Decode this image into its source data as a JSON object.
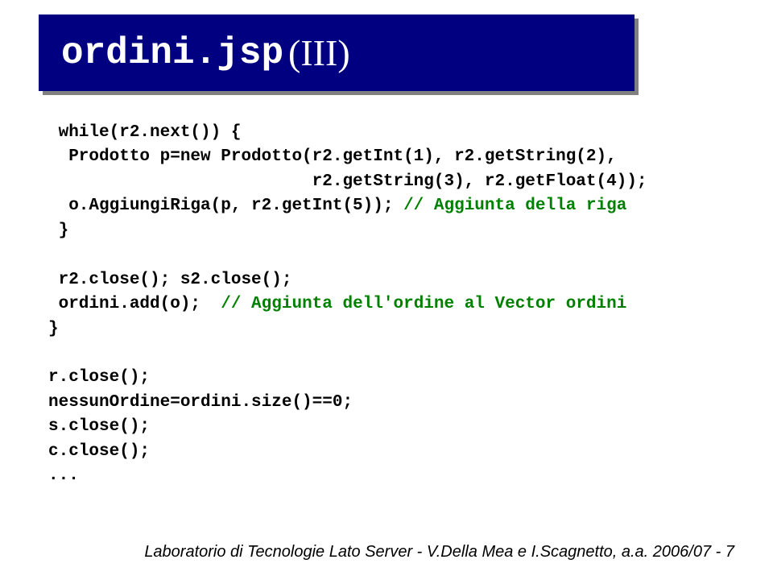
{
  "title": {
    "code_part": "ordini.jsp",
    "roman_part": "(III)"
  },
  "code": {
    "line1": " while(r2.next()) {",
    "line2": "  Prodotto p=new Prodotto(r2.getInt(1), r2.getString(2),",
    "line3": "                          r2.getString(3), r2.getFloat(4));",
    "line4a": "  o.AggiungiRiga(p, r2.getInt(5)); ",
    "line4b": "// Aggiunta della riga",
    "line5": " }",
    "line6": "",
    "line7": " r2.close(); s2.close();",
    "line8a": " ordini.add(o);  ",
    "line8b": "// Aggiunta dell'ordine al Vector ordini",
    "line9": "}",
    "line10": "",
    "line11": "r.close();",
    "line12": "nessunOrdine=ordini.size()==0;",
    "line13": "s.close();",
    "line14": "c.close();",
    "line15": "..."
  },
  "footer": "Laboratorio di Tecnologie Lato Server - V.Della Mea e I.Scagnetto, a.a. 2006/07 - 7"
}
